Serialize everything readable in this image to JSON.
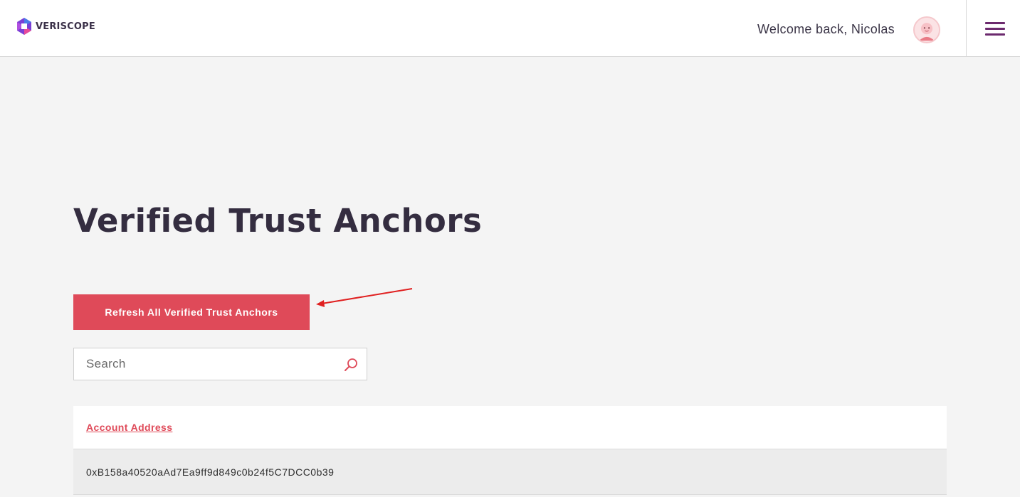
{
  "header": {
    "logo_text": "VERISCOPE",
    "welcome_text": "Welcome back, Nicolas",
    "avatar_icon": "user-avatar-icon",
    "menu_icon": "hamburger-menu-icon"
  },
  "main": {
    "title": "Verified Trust Anchors",
    "refresh_button_label": "Refresh All Verified Trust Anchors",
    "search": {
      "placeholder": "Search",
      "value": "",
      "icon": "search-icon"
    },
    "table": {
      "columns": [
        "Account Address"
      ],
      "rows": [
        [
          "0xB158a40520aAd7Ea9ff9d849c0b24f5C7DCC0b39"
        ]
      ]
    }
  },
  "colors": {
    "accent": "#df4a59",
    "menu": "#6c2a6e",
    "title": "#342d40",
    "annotation_arrow": "#e02020"
  }
}
